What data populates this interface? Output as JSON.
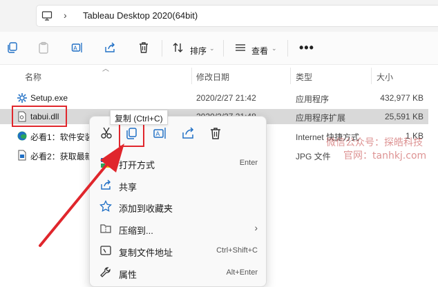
{
  "address": {
    "path": "Tableau Desktop 2020(64bit)"
  },
  "toolbar": {
    "sort_label": "排序",
    "view_label": "查看",
    "more_label": "•••"
  },
  "columns": {
    "name": "名称",
    "modified": "修改日期",
    "type": "类型",
    "size": "大小"
  },
  "files": [
    {
      "name": "Setup.exe",
      "modified": "2020/2/27 21:42",
      "type": "应用程序",
      "size": "432,977 KB",
      "icon": "gear-icon"
    },
    {
      "name": "tabui.dll",
      "modified": "2020/2/27 21:48",
      "type": "应用程序扩展",
      "size": "25,591 KB",
      "icon": "dll-file-icon"
    },
    {
      "name": "必看1：软件安装",
      "modified": "",
      "type": "Internet 快捷方式",
      "size": "1 KB",
      "icon": "edge-shortcut-icon"
    },
    {
      "name": "必看2：获取最新",
      "modified": "",
      "type": "JPG 文件",
      "size": "",
      "icon": "image-file-icon"
    }
  ],
  "tooltip": {
    "text": "复制 (Ctrl+C)"
  },
  "context_menu": {
    "quick_actions": [
      "cut-icon",
      "copy-icon",
      "rename-icon",
      "share-icon",
      "delete-icon"
    ],
    "items": [
      {
        "label": "打开方式",
        "shortcut": "Enter",
        "icon": "open-with-icon"
      },
      {
        "label": "共享",
        "shortcut": "",
        "icon": "share-icon"
      },
      {
        "label": "添加到收藏夹",
        "shortcut": "",
        "icon": "star-icon"
      },
      {
        "label": "压缩到...",
        "shortcut": "",
        "icon": "zip-folder-icon",
        "submenu": true
      },
      {
        "label": "复制文件地址",
        "shortcut": "Ctrl+Shift+C",
        "icon": "copy-path-icon"
      },
      {
        "label": "属性",
        "shortcut": "Alt+Enter",
        "icon": "wrench-icon"
      }
    ],
    "submenu_arrow": "›"
  },
  "watermark": {
    "line1": "微信公众号：探皓科技",
    "line2": "官网：tanhkj.com"
  },
  "colors": {
    "annotation_red": "#e0262c",
    "accent_blue": "#1f6fc5"
  }
}
